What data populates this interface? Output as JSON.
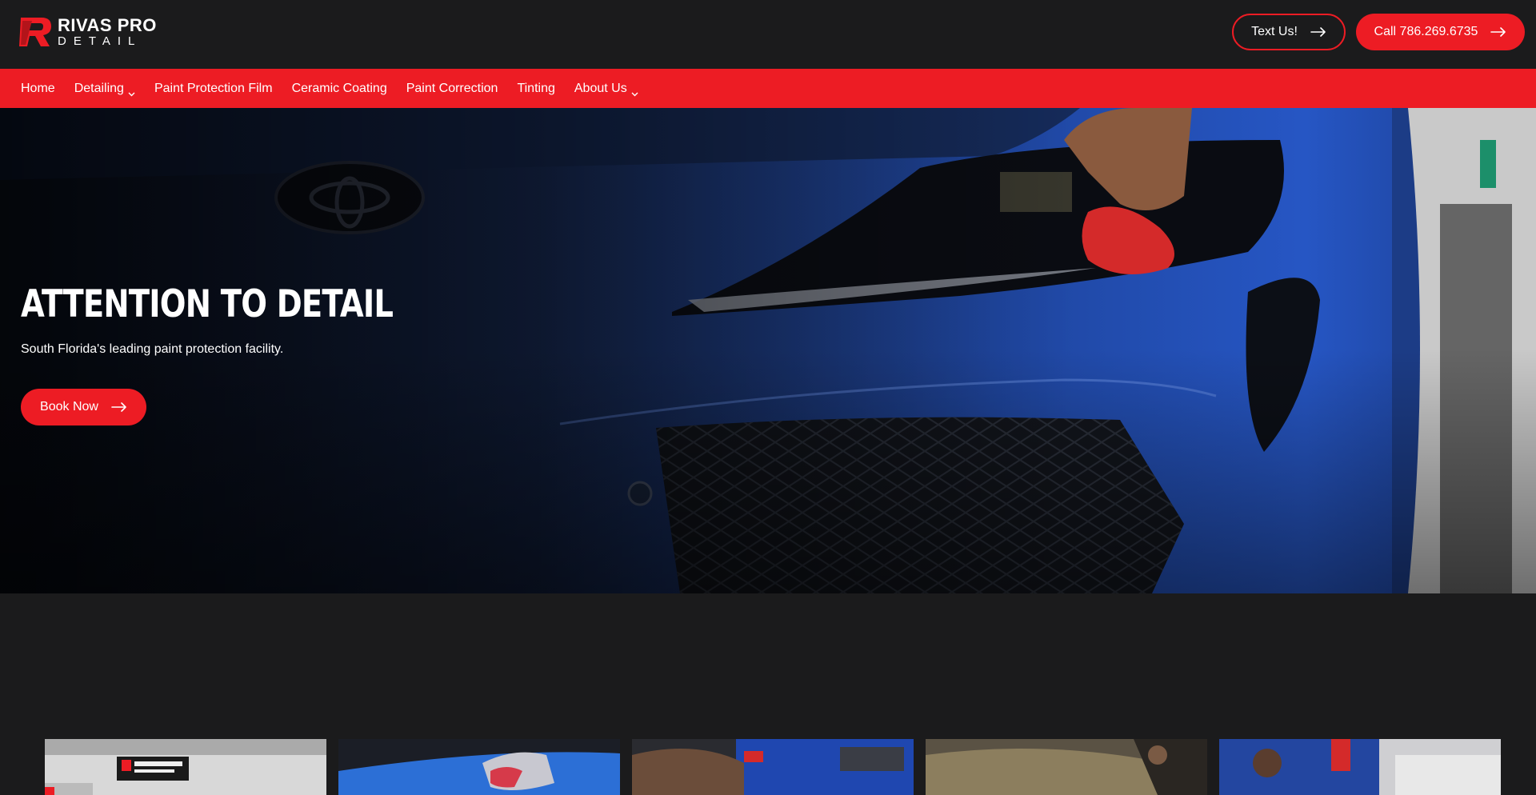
{
  "brand": {
    "name_line1": "RIVAS PRO",
    "name_line2": "DETAIL",
    "logo_letter": "R",
    "accent_color": "#ed1c24",
    "background_color": "#1b1b1c"
  },
  "header": {
    "text_button": {
      "label": "Text Us!",
      "icon": "arrow-right-icon"
    },
    "call_button": {
      "label": "Call 786.269.6735",
      "icon": "arrow-right-icon"
    }
  },
  "nav": {
    "items": [
      {
        "label": "Home",
        "has_dropdown": false
      },
      {
        "label": "Detailing",
        "has_dropdown": true
      },
      {
        "label": "Paint Protection Film",
        "has_dropdown": false
      },
      {
        "label": "Ceramic Coating",
        "has_dropdown": false
      },
      {
        "label": "Paint Correction",
        "has_dropdown": false
      },
      {
        "label": "Tinting",
        "has_dropdown": false
      },
      {
        "label": "About Us",
        "has_dropdown": true
      }
    ]
  },
  "hero": {
    "title": "ATTENTION TO DETAIL",
    "subtitle": "South Florida's leading paint protection facility.",
    "cta_label": "Book Now",
    "cta_icon": "arrow-right-icon",
    "image": "blue-car-front-headlight-photo"
  },
  "gallery": {
    "images": [
      "shop-interior-photo",
      "blue-car-wash-photo",
      "technician-working-photo",
      "gold-car-wrap-photo",
      "technician-polishing-photo"
    ]
  }
}
